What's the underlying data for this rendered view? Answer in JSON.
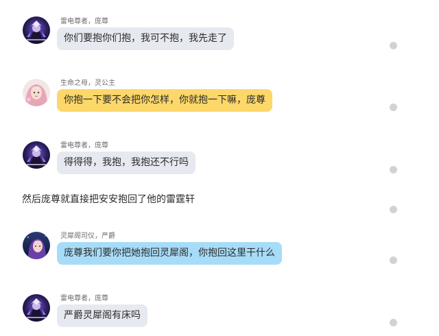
{
  "messages": [
    {
      "sender": "雷电尊者，庞尊",
      "text": "你们要抱你们抱，我可不抱，我先走了",
      "avatar_icon": "dark-warrior-avatar",
      "bubble_color": "#e6e9ef"
    },
    {
      "sender": "生命之母，灵公主",
      "text": "你抱一下要不会把你怎样，你就抱一下嘛，庞尊",
      "avatar_icon": "pink-hair-girl-avatar",
      "bubble_color": "#fcd769"
    },
    {
      "sender": "雷电尊者，庞尊",
      "text": "得得得，我抱，我抱还不行吗",
      "avatar_icon": "dark-warrior-avatar",
      "bubble_color": "#e6e9ef"
    },
    {
      "sender": "灵犀阁司仪，严爵",
      "text": "庞尊我们要你把她抱回灵犀阁，你抱回这里干什么",
      "avatar_icon": "purple-hair-avatar",
      "bubble_color": "#a7dcf8"
    },
    {
      "sender": "雷电尊者，庞尊",
      "text": "严爵灵犀阁有床吗",
      "avatar_icon": "dark-warrior-avatar",
      "bubble_color": "#e6e9ef"
    }
  ],
  "narration": "然后庞尊就直接把安安抱回了他的雷霆轩",
  "colors": {
    "grey_bubble": "#e6e9ef",
    "yellow_bubble": "#fcd769",
    "blue_bubble": "#a7dcf8",
    "status_dot": "#d2d2d2"
  }
}
